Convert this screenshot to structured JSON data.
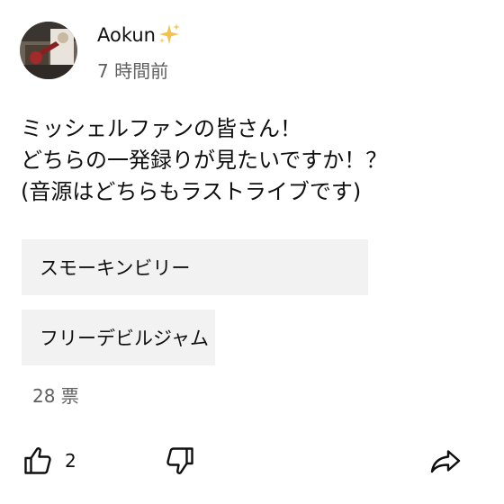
{
  "post": {
    "author": "Aokun",
    "timestamp": "7 時間前",
    "text_lines": [
      "ミッシェルファンの皆さん！",
      "どちらの一発録りが見たいですか！？",
      "(音源はどちらもラストライブです)"
    ],
    "options": [
      {
        "label": "スモーキンビリー",
        "fill": 0.72
      },
      {
        "label": "フリーデビルジャム",
        "fill": 0.4
      }
    ],
    "votes": "28 票",
    "likes": "2"
  },
  "icons": {
    "author_badge": "sparkle-icon",
    "like": "thumbs-up-icon",
    "dislike": "thumbs-down-icon",
    "share": "share-icon"
  },
  "colors": {
    "option_fill": "#f2f2f2",
    "secondary_text": "#606060",
    "sparkle": "#f2c14e"
  }
}
